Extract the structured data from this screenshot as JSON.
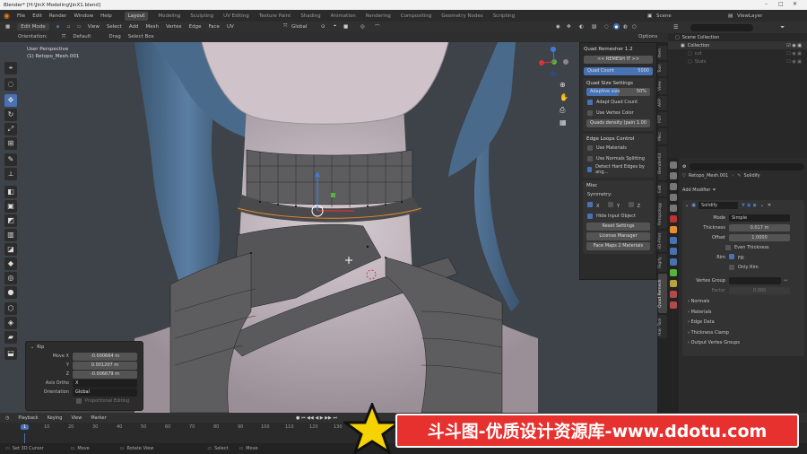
{
  "titlebar": {
    "title": "Blender* [H:\\JinX Modeling\\JinX1.blend]"
  },
  "menu": {
    "items": [
      "File",
      "Edit",
      "Render",
      "Window",
      "Help"
    ],
    "workspaces": [
      "Layout",
      "Modeling",
      "Sculpting",
      "UV Editing",
      "Texture Paint",
      "Shading",
      "Animation",
      "Rendering",
      "Compositing",
      "Geometry Nodes",
      "Scripting"
    ],
    "active_workspace": "Layout",
    "scene_label": "Scene",
    "viewlayer_label": "ViewLayer"
  },
  "header": {
    "mode": "Edit Mode",
    "menus": [
      "View",
      "Select",
      "Add",
      "Mesh",
      "Vertex",
      "Edge",
      "Face",
      "UV"
    ],
    "transform": "Global",
    "options": "Options",
    "orientation_label": "Orientation:",
    "orientation_value": "Default",
    "drag_label": "Drag",
    "drag_value": "Select Box"
  },
  "viewport": {
    "line1": "User Perspective",
    "line2": "(1) Retopo_Mesh.001"
  },
  "npanel": {
    "title": "Quad Remesher 1.2",
    "remesh_button": "<< REMESH IT >>",
    "quad_count_label": "Quad Count",
    "quad_count_value": "5000",
    "size_settings_title": "Quad Size Settings",
    "adaptive_label": "Adaptive size",
    "adaptive_value": "50%",
    "adapt_quad_count": "Adapt Quad Count",
    "use_vertex_color": "Use Vertex Color",
    "quads_density_button": "Quads density (pain 1.00",
    "edge_loops_title": "Edge Loops Control",
    "use_materials": "Use Materials",
    "use_normals": "Use Normals Splitting",
    "detect_hard": "Detect Hard Edges by ang...",
    "misc_title": "Misc",
    "symmetry_label": "Symmetry:",
    "sym_x": "X",
    "sym_y": "Y",
    "sym_z": "Z",
    "hide_input": "Hide Input Object",
    "reset_settings": "Reset Settings",
    "license_manager": "License Manager",
    "face_maps": "Face Maps 2 Materials"
  },
  "vtabs": [
    "Item",
    "Tool",
    "View",
    "ARP",
    "PDT",
    "Misc",
    "BlenderKit",
    "Edit",
    "Retopology",
    "3D-Print",
    "Rigify",
    "Quad Remesh",
    "Hair Tool"
  ],
  "outliner": {
    "title": "Scene Collection",
    "rows": [
      "Collection",
      "cut",
      "Stats"
    ]
  },
  "properties": {
    "object_name": "Retopo_Mesh.001",
    "modifier_type": "Solidify",
    "add_modifier": "Add Modifier",
    "modifier_name": "Solidify",
    "mode_label": "Mode",
    "mode_value": "Simple",
    "thickness_label": "Thickness",
    "thickness_value": "0.017 m",
    "offset_label": "Offset",
    "offset_value": "1.0000",
    "even_thickness": "Even Thickness",
    "rim_label": "Rim",
    "fill_label": "Fill",
    "only_rim": "Only Rim",
    "vertex_group_label": "Vertex Group",
    "factor_label": "Factor",
    "factor_value": "0.000",
    "sections": [
      "Normals",
      "Materials",
      "Edge Data",
      "Thickness Clamp",
      "Output Vertex Groups"
    ]
  },
  "operator": {
    "title": "Rip",
    "move_x_label": "Move X",
    "move_x": "-0.000664 m",
    "y_label": "Y",
    "y": "0.001207 m",
    "z_label": "Z",
    "z": "-0.006679 m",
    "axis_ortho_label": "Axis Ortho",
    "axis_ortho": "X",
    "orientation_label": "Orientation",
    "orientation": "Global",
    "proportional": "Proportional Editing"
  },
  "timeline": {
    "menus": [
      "Playback",
      "Keying",
      "View",
      "Marker"
    ],
    "current_frame": "1",
    "ticks": [
      "10",
      "20",
      "30",
      "40",
      "50",
      "60",
      "70",
      "80",
      "90",
      "100",
      "110",
      "120",
      "130"
    ]
  },
  "statusbar": {
    "items": [
      "Set 3D Cursor",
      "Move",
      "Rotate View",
      "Select",
      "Move"
    ]
  },
  "watermark": {
    "text": "斗斗图-优质设计资源库-www.ddotu.com"
  },
  "colors": {
    "accent": "#4772b3",
    "watermark_red": "#e6312f",
    "skin": "#c9bcc4",
    "hair": "#4f6e8f"
  }
}
